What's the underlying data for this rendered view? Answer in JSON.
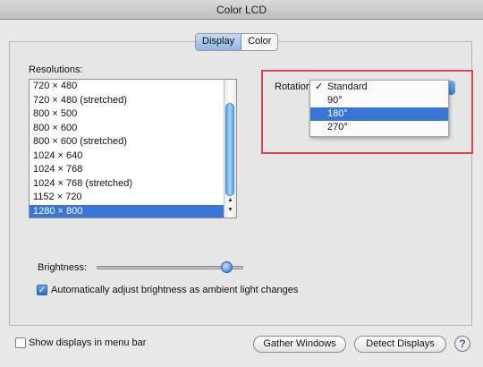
{
  "window": {
    "title": "Color LCD"
  },
  "tabs": [
    {
      "label": "Display",
      "active": true
    },
    {
      "label": "Color",
      "active": false
    }
  ],
  "resolutions": {
    "label": "Resolutions:",
    "items": [
      "720 × 480",
      "720 × 480 (stretched)",
      "800 × 500",
      "800 × 600",
      "800 × 600 (stretched)",
      "1024 × 640",
      "1024 × 768",
      "1024 × 768 (stretched)",
      "1152 × 720",
      "1280 × 800"
    ],
    "selected": "1280 × 800"
  },
  "rotation": {
    "label": "Rotation:",
    "options": [
      {
        "label": "Standard",
        "checked": true,
        "highlighted": false
      },
      {
        "label": "90°",
        "checked": false,
        "highlighted": false
      },
      {
        "label": "180°",
        "checked": false,
        "highlighted": true
      },
      {
        "label": "270°",
        "checked": false,
        "highlighted": false
      }
    ]
  },
  "brightness": {
    "label": "Brightness:",
    "level_fraction": 0.88
  },
  "auto_brightness": {
    "label": "Automatically adjust brightness as ambient light changes",
    "checked": true
  },
  "menu_bar": {
    "label": "Show displays in menu bar",
    "checked": false
  },
  "buttons": {
    "gather": "Gather Windows",
    "detect": "Detect Displays",
    "help": "?"
  },
  "colors": {
    "selection": "#3875d7",
    "highlight_box": "#e0474d"
  }
}
